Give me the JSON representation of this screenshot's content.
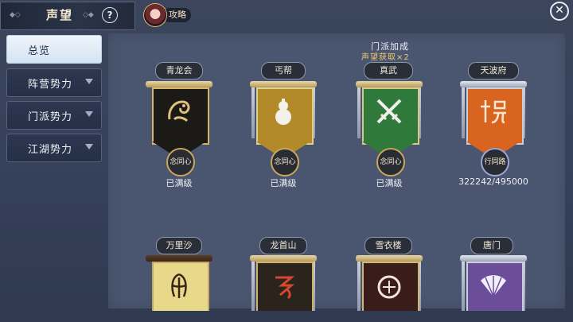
{
  "header": {
    "title": "声望",
    "help_label": "?",
    "guide_label": "攻略",
    "close_label": "✕"
  },
  "sidebar": {
    "items": [
      {
        "label": "总览",
        "active": true,
        "has_arrow": false
      },
      {
        "label": "阵营势力",
        "active": false,
        "has_arrow": true
      },
      {
        "label": "门派势力",
        "active": false,
        "has_arrow": true
      },
      {
        "label": "江湖势力",
        "active": false,
        "has_arrow": true
      }
    ]
  },
  "bonus": {
    "title": "门派加成",
    "subtitle": "声望获取×2"
  },
  "factions": [
    {
      "name": "青龙会",
      "seal": "念同心",
      "status": "已满级",
      "flag_color": "#1c1a17",
      "border_color": "#d6b46a",
      "icon": "dragon-icon"
    },
    {
      "name": "丐帮",
      "seal": "念同心",
      "status": "已满级",
      "flag_color": "#b38a2a",
      "border_color": "#e2cf8e",
      "icon": "gourd-icon"
    },
    {
      "name": "真武",
      "seal": "念同心",
      "status": "已满级",
      "flag_color": "#2f7a3a",
      "border_color": "#dcc78a",
      "icon": "crossed-swords-icon"
    },
    {
      "name": "天波府",
      "seal": "行同路",
      "status": "322242/495000",
      "flag_color": "#d9641f",
      "border_color": "#c9cfdb",
      "icon": "yang-emblem-icon"
    },
    {
      "name": "万里沙",
      "seal": "",
      "status": "",
      "flag_color": "#e8d98a",
      "border_color": "#c9a86a",
      "icon": "tentacle-icon"
    },
    {
      "name": "龙首山",
      "seal": "",
      "status": "",
      "flag_color": "#2a241d",
      "border_color": "#d0b06a",
      "icon": "dragon-script-icon"
    },
    {
      "name": "雪衣楼",
      "seal": "",
      "status": "",
      "flag_color": "#3a1d1a",
      "border_color": "#d2b473",
      "icon": "circle-crest-icon"
    },
    {
      "name": "唐门",
      "seal": "",
      "status": "",
      "flag_color": "#6b4d9a",
      "border_color": "#c9cfdb",
      "icon": "fan-icon"
    }
  ]
}
